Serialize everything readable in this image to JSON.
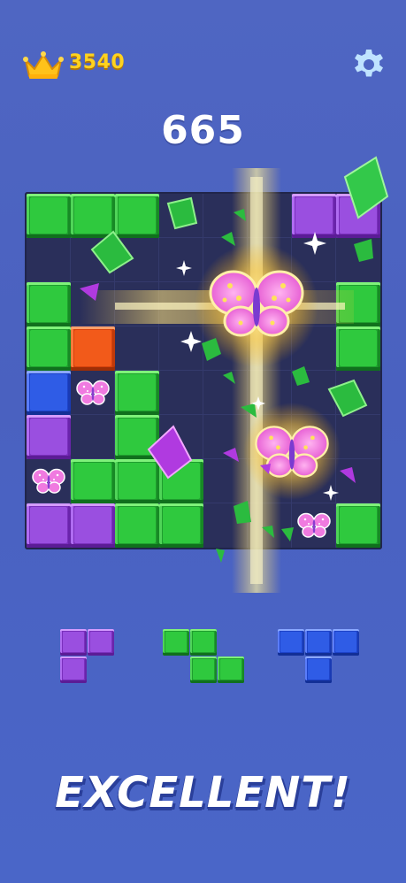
{
  "hud": {
    "coins": "3540",
    "score": "665",
    "crown_icon": "crown-icon",
    "settings_icon": "gear-icon"
  },
  "board": {
    "size": 8,
    "cells": [
      {
        "row": 0,
        "col": 0,
        "color": "green"
      },
      {
        "row": 0,
        "col": 1,
        "color": "green"
      },
      {
        "row": 0,
        "col": 2,
        "color": "green"
      },
      {
        "row": 0,
        "col": 6,
        "color": "purple"
      },
      {
        "row": 0,
        "col": 7,
        "color": "purple"
      },
      {
        "row": 2,
        "col": 0,
        "color": "green"
      },
      {
        "row": 2,
        "col": 7,
        "color": "green"
      },
      {
        "row": 3,
        "col": 0,
        "color": "green"
      },
      {
        "row": 3,
        "col": 1,
        "color": "orange"
      },
      {
        "row": 3,
        "col": 7,
        "color": "green"
      },
      {
        "row": 4,
        "col": 0,
        "color": "blue"
      },
      {
        "row": 4,
        "col": 2,
        "color": "green"
      },
      {
        "row": 5,
        "col": 0,
        "color": "purple"
      },
      {
        "row": 5,
        "col": 2,
        "color": "green"
      },
      {
        "row": 6,
        "col": 1,
        "color": "green"
      },
      {
        "row": 6,
        "col": 2,
        "color": "green"
      },
      {
        "row": 6,
        "col": 3,
        "color": "green"
      },
      {
        "row": 7,
        "col": 0,
        "color": "purple"
      },
      {
        "row": 7,
        "col": 1,
        "color": "purple"
      },
      {
        "row": 7,
        "col": 2,
        "color": "green"
      },
      {
        "row": 7,
        "col": 3,
        "color": "green"
      },
      {
        "row": 7,
        "col": 7,
        "color": "green"
      }
    ],
    "butterflies": [
      {
        "row": 4,
        "col": 1
      },
      {
        "row": 6,
        "col": 0
      },
      {
        "row": 7,
        "col": 6
      }
    ]
  },
  "pieces": [
    {
      "name": "piece-purple-corner",
      "color": "purple",
      "blocks": [
        [
          0,
          0
        ],
        [
          0,
          1
        ],
        [
          1,
          0
        ]
      ]
    },
    {
      "name": "piece-green-z",
      "color": "green",
      "blocks": [
        [
          0,
          0
        ],
        [
          0,
          1
        ],
        [
          1,
          1
        ],
        [
          1,
          2
        ]
      ]
    },
    {
      "name": "piece-blue-t",
      "color": "blue",
      "blocks": [
        [
          0,
          0
        ],
        [
          0,
          1
        ],
        [
          0,
          2
        ],
        [
          1,
          1
        ]
      ]
    }
  ],
  "message": "EXCELLENT!",
  "colors": {
    "background": "#4f66c2",
    "board": "#2a2f5a",
    "coin_text": "#ffd21f",
    "green": "#2fc93e",
    "purple": "#9a4fe0",
    "orange": "#f25a1a",
    "blue": "#2f5ce6"
  }
}
